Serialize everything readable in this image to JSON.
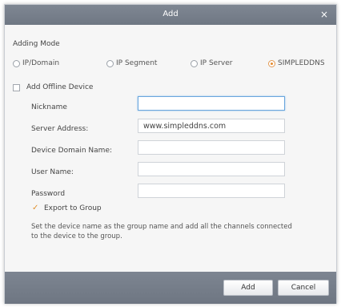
{
  "dialog": {
    "title": "Add",
    "close_icon": "×"
  },
  "adding_mode": {
    "label": "Adding Mode",
    "options": [
      {
        "label": "IP/Domain",
        "selected": false
      },
      {
        "label": "IP Segment",
        "selected": false
      },
      {
        "label": "IP Server",
        "selected": false
      },
      {
        "label": "SIMPLEDDNS",
        "selected": true
      }
    ]
  },
  "offline": {
    "label": "Add Offline Device",
    "checked": false
  },
  "fields": {
    "nickname": {
      "label": "Nickname",
      "value": ""
    },
    "server_address": {
      "label": "Server Address:",
      "value": "www.simpleddns.com"
    },
    "device_domain": {
      "label": "Device Domain Name:",
      "value": ""
    },
    "user_name": {
      "label": "User Name:",
      "value": ""
    },
    "password": {
      "label": "Password",
      "value": ""
    }
  },
  "export_group": {
    "label": "Export to Group",
    "checked": true
  },
  "note": "Set the device name as the group name and add all the channels connected to the device to the group.",
  "buttons": {
    "add": "Add",
    "cancel": "Cancel"
  },
  "colors": {
    "accent": "#e58a2c",
    "titlebar": "#767e8a",
    "focus": "#6aa6dd"
  }
}
